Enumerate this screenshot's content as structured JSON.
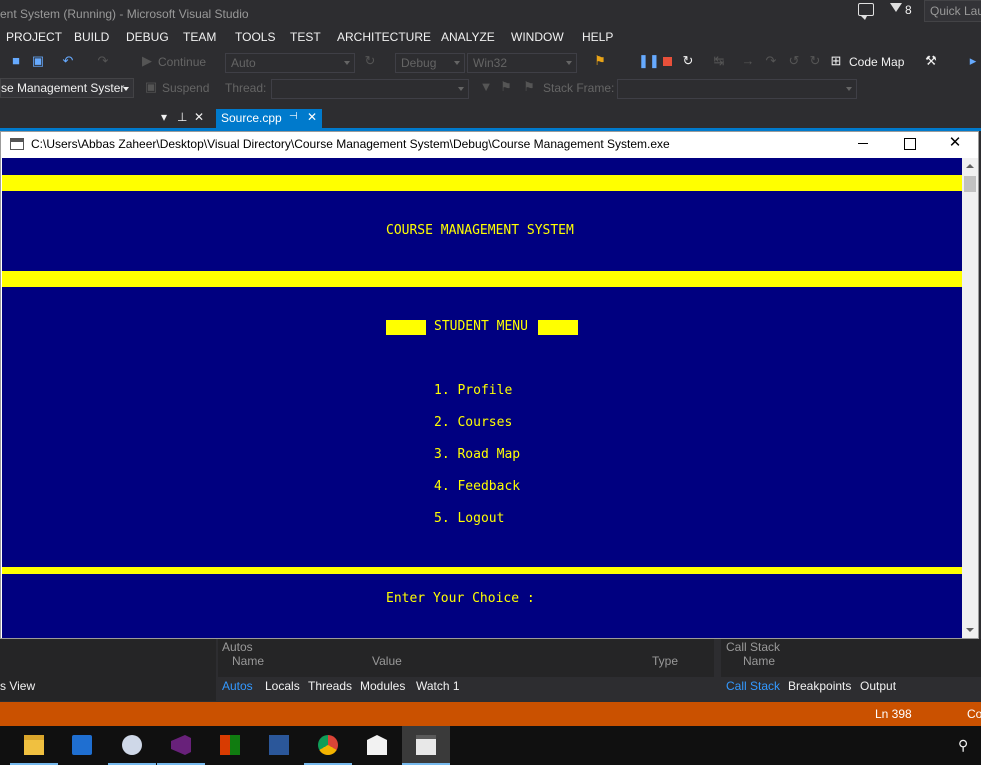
{
  "vs": {
    "title": "ent System (Running) - Microsoft Visual Studio",
    "notification_count": "8",
    "quick_launch_placeholder": "Quick Lau",
    "menu": [
      "PROJECT",
      "BUILD",
      "DEBUG",
      "TEAM",
      "TOOLS",
      "TEST",
      "ARCHITECTURE",
      "ANALYZE",
      "WINDOW",
      "HELP"
    ],
    "toolbar": {
      "continue_label": "Continue",
      "autos_combo": "Auto",
      "config_combo": "Debug",
      "platform_combo": "Win32",
      "codemap_label": "Code Map"
    },
    "debug_toolbar": {
      "process_combo": "se Management Syster",
      "suspend_label": "Suspend",
      "thread_label": "Thread:",
      "stack_frame_label": "Stack Frame:"
    },
    "tabs": {
      "active_tab": "Source.cpp",
      "pin_glyph": "⊣",
      "close_glyph": "✕"
    }
  },
  "console": {
    "title": "C:\\Users\\Abbas Zaheer\\Desktop\\Visual Directory\\Course Management System\\Debug\\Course Management System.exe",
    "heading": "COURSE MANAGEMENT SYSTEM",
    "menu_title": "STUDENT MENU",
    "options": [
      "1. Profile",
      "2. Courses",
      "3. Road Map",
      "4. Feedback",
      "5. Logout"
    ],
    "prompt": "Enter Your Choice :",
    "colors": {
      "background": "#000080",
      "foreground": "#ffff00"
    }
  },
  "bottom": {
    "autos_title": "Autos",
    "columns": {
      "name": "Name",
      "value": "Value",
      "type": "Type"
    },
    "left_tabs": [
      "Autos",
      "Locals",
      "Threads",
      "Modules",
      "Watch 1"
    ],
    "callstack_title": "Call Stack",
    "callstack_column": "Name",
    "right_tabs": [
      "Call Stack",
      "Breakpoints",
      "Output"
    ],
    "left_edge_label": "s View"
  },
  "status": {
    "line": "Ln 398",
    "col": "Co",
    "color": "#ca5100"
  },
  "taskbar": {
    "apps": [
      "file-explorer-icon",
      "store-icon",
      "paint-icon",
      "visual-studio-icon",
      "office-icon",
      "word-icon",
      "chrome-icon",
      "mail-icon",
      "console-app-icon"
    ]
  }
}
